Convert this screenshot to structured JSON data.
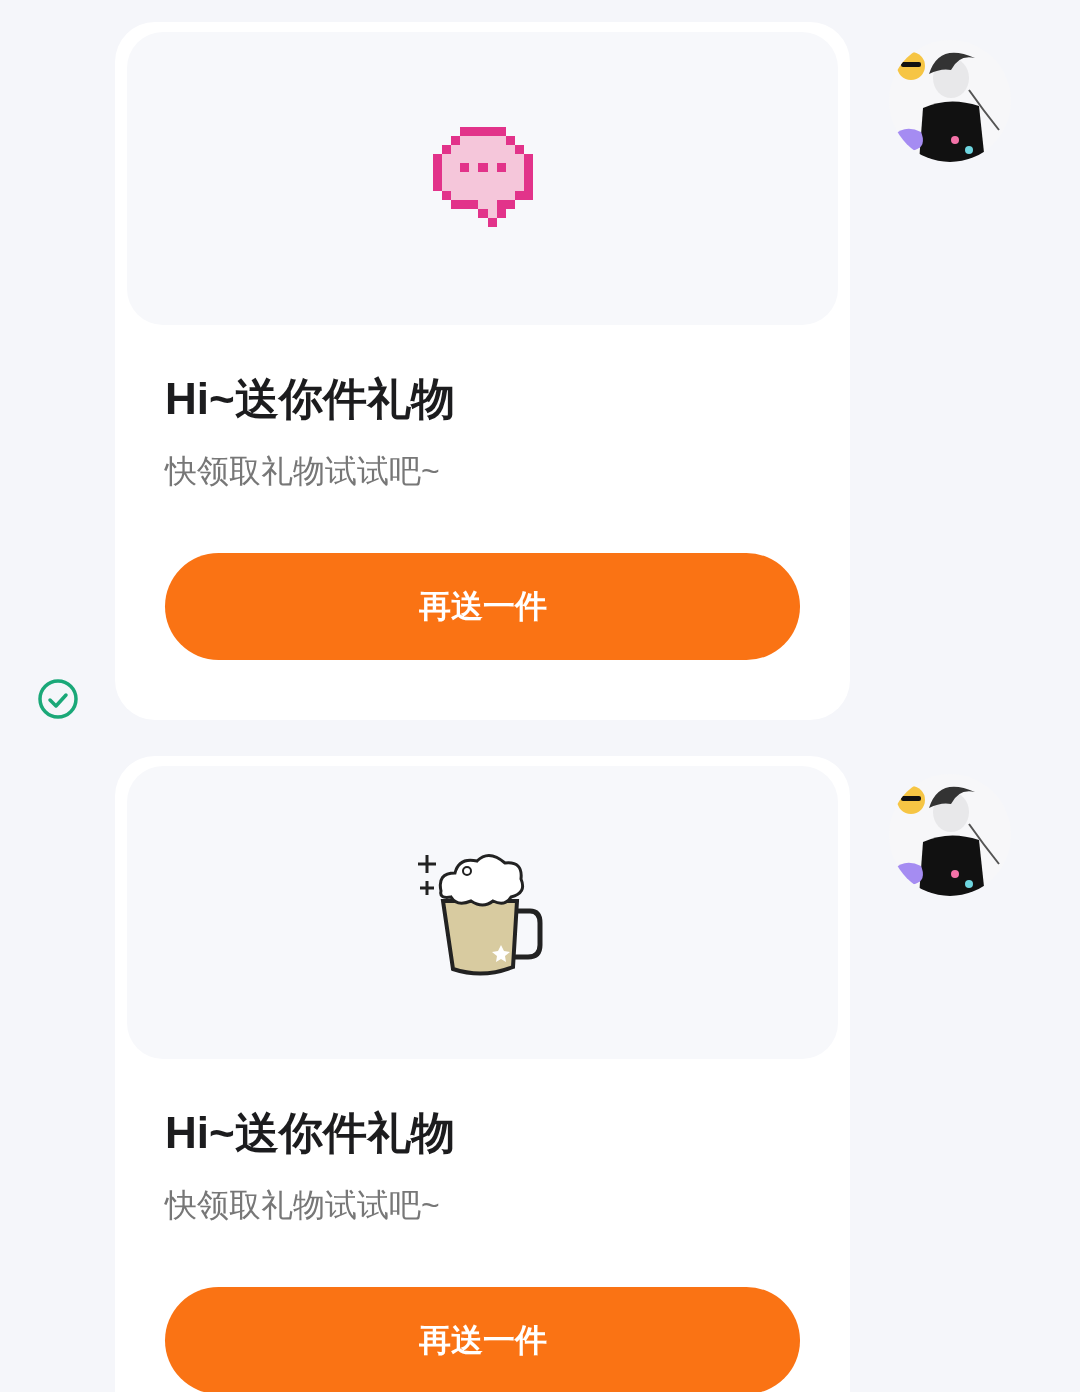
{
  "messages": [
    {
      "kind": "speech-bubble",
      "delivered": true,
      "title": "Hi~送你件礼物",
      "subtitle": "快领取礼物试试吧~",
      "button": "再送一件"
    },
    {
      "kind": "beer",
      "title": "Hi~送你件礼物",
      "subtitle": "快领取礼物试试吧~",
      "button": "再送一件"
    }
  ]
}
